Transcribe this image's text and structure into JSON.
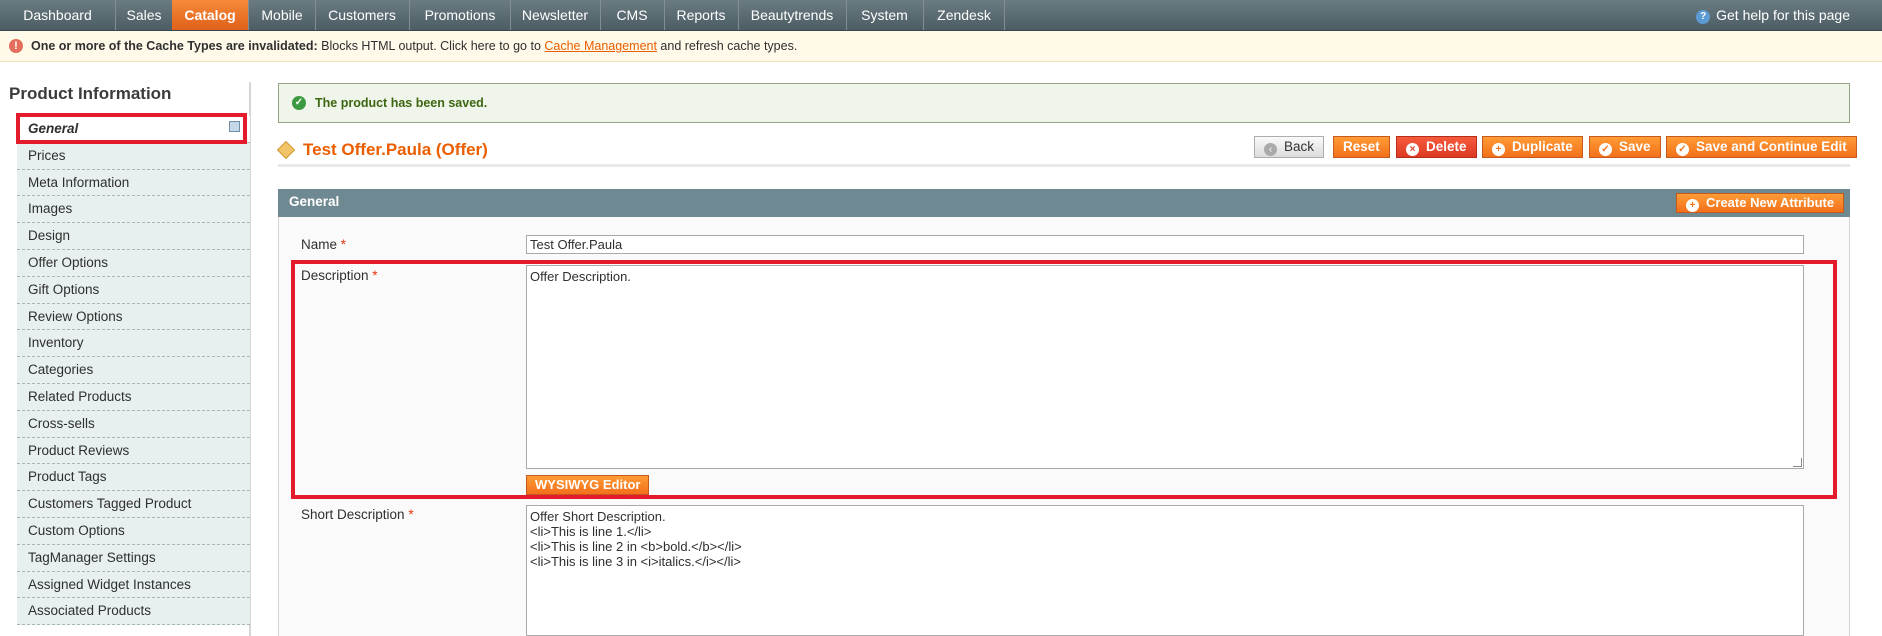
{
  "nav": {
    "items": [
      "Dashboard",
      "Sales",
      "Catalog",
      "Mobile",
      "Customers",
      "Promotions",
      "Newsletter",
      "CMS",
      "Reports",
      "Beautytrends",
      "System",
      "Zendesk"
    ],
    "active": "Catalog",
    "help": "Get help for this page"
  },
  "notice": {
    "bold": "One or more of the Cache Types are invalidated:",
    "text1": " Blocks HTML output. Click here to go to ",
    "link": "Cache Management",
    "text2": " and refresh cache types."
  },
  "sidebar": {
    "title": "Product Information",
    "items": [
      "General",
      "Prices",
      "Meta Information",
      "Images",
      "Design",
      "Offer Options",
      "Gift Options",
      "Review Options",
      "Inventory",
      "Categories",
      "Related Products",
      "Cross-sells",
      "Product Reviews",
      "Product Tags",
      "Customers Tagged Product",
      "Custom Options",
      "TagManager Settings",
      "Assigned Widget Instances",
      "Associated Products"
    ],
    "active": "General"
  },
  "message": {
    "success": "The product has been saved."
  },
  "header": {
    "title": "Test Offer.Paula (Offer)",
    "buttons": {
      "back": "Back",
      "reset": "Reset",
      "delete": "Delete",
      "duplicate": "Duplicate",
      "save": "Save",
      "save_continue": "Save and Continue Edit"
    }
  },
  "fieldset": {
    "title": "General",
    "create_attribute": "Create New Attribute",
    "name_label": "Name",
    "name_value": "Test Offer.Paula",
    "description_label": "Description",
    "description_value": "Offer Description.",
    "wysiwyg": "WYSIWYG Editor",
    "short_description_label": "Short Description",
    "short_description_value": "Offer Short Description.\n<li>This is line 1.</li>\n<li>This is line 2 in <b>bold.</b></li>\n<li>This is line 3 in <i>italics.</i></li>",
    "required_mark": "*"
  },
  "colors": {
    "accent": "#eb5e00",
    "highlight": "#e41b2b",
    "nav": "#5a6b71"
  }
}
